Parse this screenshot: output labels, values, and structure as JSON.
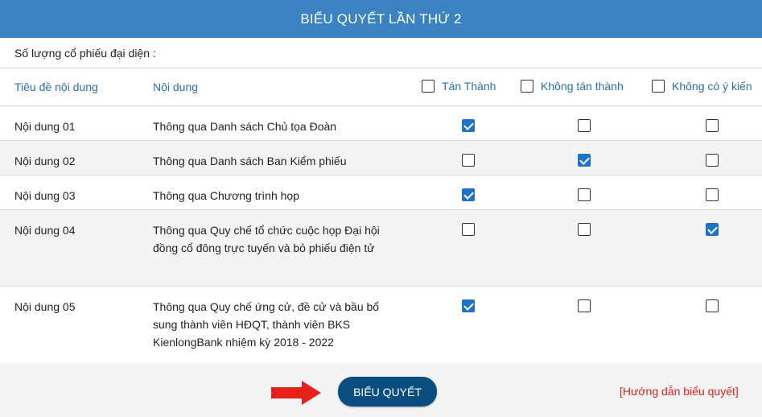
{
  "title": "BIỂU QUYẾT LẦN THỨ 2",
  "shares": {
    "label": "Số lượng cổ phiếu đại diện :",
    "value": ""
  },
  "headers": {
    "title_col": "Tiêu đề nội dung",
    "content_col": "Nội dung",
    "approve": "Tán Thành",
    "disapprove": "Không tán thành",
    "no_opinion": "Không có ý kiến"
  },
  "rows": [
    {
      "title": "Nội dung 01",
      "content": "Thông qua Danh sách Chủ tọa Đoàn",
      "vote": "approve"
    },
    {
      "title": "Nội dung 02",
      "content": "Thông qua Danh sách Ban Kiểm phiếu",
      "vote": "disapprove"
    },
    {
      "title": "Nội dung 03",
      "content": "Thông qua Chương trình họp",
      "vote": "approve"
    },
    {
      "title": "Nội dung 04",
      "content": "Thông qua Quy chế tổ chức cuộc họp Đại hội đồng cổ đông trực tuyến và bỏ phiếu điện tử",
      "vote": "no_opinion"
    },
    {
      "title": "Nội dung 05",
      "content": "Thông qua Quy chế ứng cử, đề cử và bầu bổ sung thành viên HĐQT, thành viên BKS KienlongBank nhiệm kỳ 2018 - 2022",
      "vote": "approve"
    }
  ],
  "vote_button": "BIỂU QUYẾT",
  "guide_link": "[Hướng dẫn biểu quyết]",
  "colors": {
    "header_bg": "#3a82c0",
    "button_bg": "#0a4d7f",
    "check_blue": "#1e73c8",
    "link_red": "#e0211c",
    "arrow_red": "#e8201a"
  },
  "icons": {
    "arrow": "right-arrow-icon"
  }
}
